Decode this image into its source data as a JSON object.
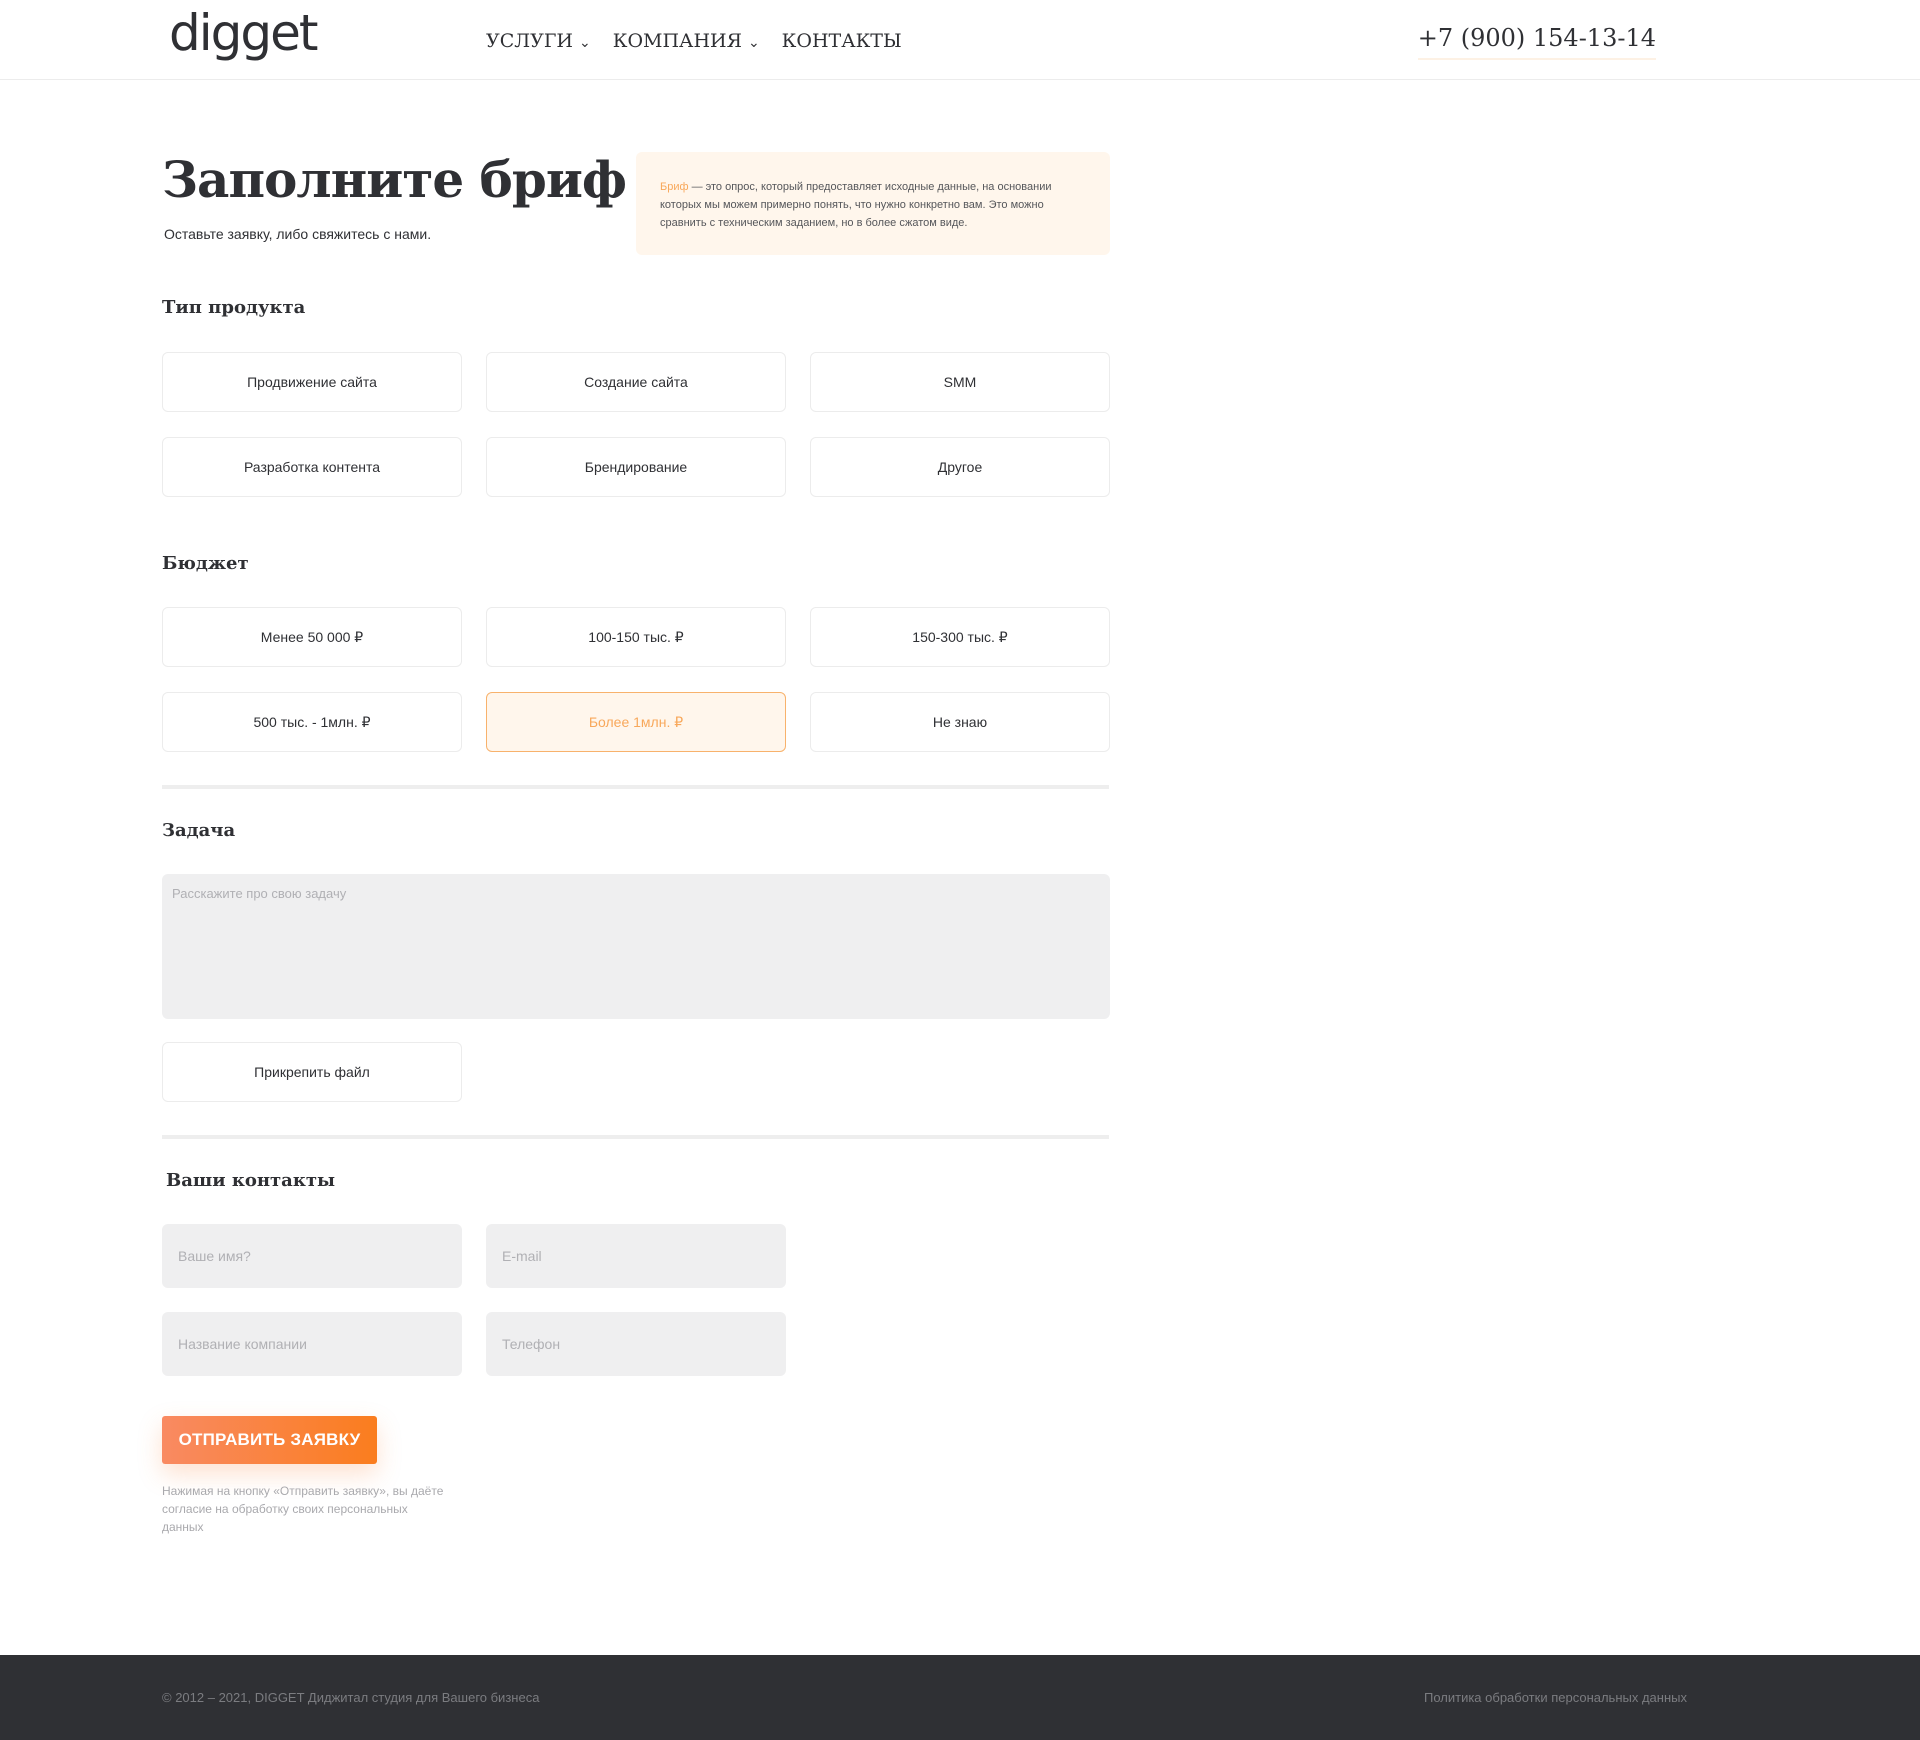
{
  "header": {
    "logo": "digget",
    "nav": [
      {
        "label": "УСЛУГИ",
        "has_dropdown": true
      },
      {
        "label": "КОМПАНИЯ",
        "has_dropdown": true
      },
      {
        "label": "КОНТАКТЫ",
        "has_dropdown": false
      }
    ],
    "chevron_glyph": "⌄",
    "phone": "+7 (900) 154-13-14"
  },
  "hero": {
    "title": "Заполните бриф",
    "subtitle": "Оставьте заявку, либо свяжитесь с нами.",
    "brief_term": "Бриф",
    "brief_text": " — это опрос, который предоставляет исходные данные, на основании которых мы можем примерно понять, что нужно конкретно вам. Это можно сравнить с техническим заданием, но в более сжатом виде."
  },
  "product_type": {
    "heading": "Тип продукта",
    "options": [
      "Продвижение сайта",
      "Создание сайта",
      "SMM",
      "Разработка контента",
      "Брендирование",
      "Другое"
    ]
  },
  "budget": {
    "heading": "Бюджет",
    "options": [
      "Менее 50 000 ₽",
      "100-150 тыс. ₽",
      "150-300 тыс. ₽",
      "500 тыс. - 1млн. ₽",
      "Более 1млн. ₽",
      "Не знаю"
    ],
    "selected": "Более 1млн. ₽"
  },
  "task": {
    "heading": "Задача",
    "placeholder": "Расскажите про свою задачу",
    "attach_label": "Прикрепить файл"
  },
  "contacts": {
    "heading": "Ваши контакты",
    "name_placeholder": "Ваше имя?",
    "email_placeholder": "E-mail",
    "company_placeholder": "Название компании",
    "phone_placeholder": "Телефон"
  },
  "submit": {
    "label": "ОТПРАВИТЬ ЗАЯВКУ",
    "consent": "Нажимая на кнопку «Отправить заявку», вы даёте согласие на обработку своих персональных данных"
  },
  "footer": {
    "copyright": "© 2012 – 2021, DIGGET Диджитал студия для Вашего бизнеса",
    "policy": "Политика обработки персональных данных"
  },
  "colors": {
    "accent": "#f8a85b",
    "accent_bg": "#fff6ec",
    "button_gradient_start": "#f98a62",
    "button_gradient_end": "#fa7d1e",
    "footer_bg": "#2f3034",
    "field_bg": "#efeff0"
  }
}
